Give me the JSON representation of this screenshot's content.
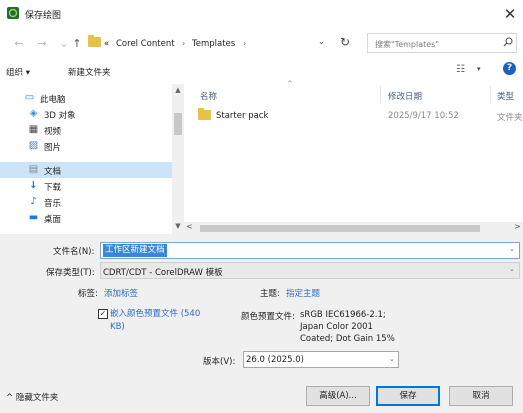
{
  "window": {
    "title": "保存绘图",
    "close_glyph": "✕"
  },
  "address_bar": {
    "back_glyph": "←",
    "forward_glyph": "→",
    "up_glyph": "↑",
    "overflow": "«",
    "crumbs": [
      "Corel Content",
      "Templates"
    ],
    "separator": "›",
    "dropdown_glyph": "⌄",
    "refresh_glyph": "↻"
  },
  "search": {
    "placeholder": "搜索\"Templates\"",
    "icon": "search-icon"
  },
  "toolbar": {
    "organize_label": "组织 ▾",
    "new_folder_label": "新建文件夹",
    "view_glyph": "☷",
    "view_dd": "▾",
    "help_glyph": "?"
  },
  "nav": {
    "scroll_up": "▲",
    "scroll_down": "▼",
    "items": [
      {
        "label": "此电脑",
        "icon": "computer-icon",
        "glyph": "▭",
        "color": "#1f7dd6"
      },
      {
        "label": "3D 对象",
        "icon": "3d-objects-icon",
        "glyph": "◈",
        "color": "#3b8fd9"
      },
      {
        "label": "视频",
        "icon": "video-icon",
        "glyph": "▦",
        "color": "#444444"
      },
      {
        "label": "图片",
        "icon": "pictures-icon",
        "glyph": "▨",
        "color": "#5a7fa8"
      },
      {
        "label": "文档",
        "icon": "documents-icon",
        "glyph": "▤",
        "color": "#7a8a99"
      },
      {
        "label": "下载",
        "icon": "downloads-icon",
        "glyph": "↓",
        "color": "#1f7dd6"
      },
      {
        "label": "音乐",
        "icon": "music-icon",
        "glyph": "♪",
        "color": "#1f7dd6"
      },
      {
        "label": "桌面",
        "icon": "desktop-icon",
        "glyph": "▬",
        "color": "#1f7dd6"
      }
    ],
    "selected_index": 4
  },
  "file_list": {
    "sort_caret": "^",
    "columns": [
      "名称",
      "修改日期",
      "类型"
    ],
    "rows": [
      {
        "name": "Starter pack",
        "modified": "2025/9/17 10:52",
        "type": "文件夹"
      }
    ],
    "hscroll_left": "<",
    "hscroll_right": ">"
  },
  "form": {
    "filename_label": "文件名(N):",
    "filename_value": "工作区新建文档",
    "filetype_label": "保存类型(T):",
    "filetype_value": "CDRT/CDT - CorelDRAW 模板",
    "dropdown_glyph": "⌄",
    "tags_label": "标签:",
    "tags_value": "添加标签",
    "subject_label": "主题:",
    "subject_value": "指定主题",
    "embed_checked": true,
    "check_glyph": "✓",
    "embed_label": "嵌入颜色预置文件 (540 KB)",
    "profile_label": "颜色预置文件:",
    "profile_lines": [
      "sRGB IEC61966-2.1;",
      "Japan Color 2001",
      "Coated; Dot Gain 15%"
    ],
    "version_label": "版本(V):",
    "version_value": "26.0 (2025.0)"
  },
  "footer": {
    "hide_folders_label": "^ 隐藏文件夹",
    "advanced_label": "高级(A)...",
    "save_label": "保存",
    "cancel_label": "取消"
  },
  "colors": {
    "accent": "#0078d7",
    "selection": "#cce4f7",
    "link": "#2a6cc7",
    "form_bg": "#f0f0f0"
  }
}
